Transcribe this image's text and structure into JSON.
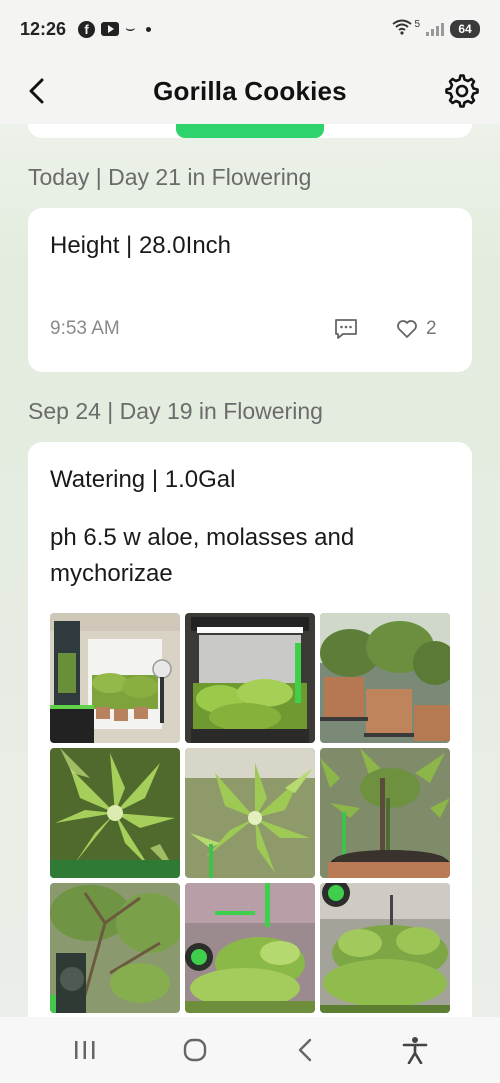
{
  "status_bar": {
    "time": "12:26",
    "battery": "64",
    "wifi_label": "5"
  },
  "header": {
    "title": "Gorilla Cookies",
    "back_icon": "chevron-left-icon",
    "settings_icon": "gear-icon"
  },
  "entries": [
    {
      "date_heading": "Today | Day 21 in Flowering",
      "title": "Height | 28.0Inch",
      "time": "9:53 AM",
      "likes": "2"
    },
    {
      "date_heading": "Sep 24 | Day 19 in Flowering",
      "title": "Watering | 1.0Gal",
      "note": "ph 6.5 w aloe, molasses and mychorizae",
      "photos": [
        "grow-tent-room",
        "tent-top-view",
        "potted-plants",
        "leaf-closeup-1",
        "leaf-closeup-2",
        "plant-stem-pot",
        "plant-branches",
        "canopy-top",
        "canopy-fan"
      ]
    }
  ],
  "colors": {
    "accent": "#2fd36b",
    "leaf_green": "#8fbf3a",
    "background": "#e6ece3"
  }
}
